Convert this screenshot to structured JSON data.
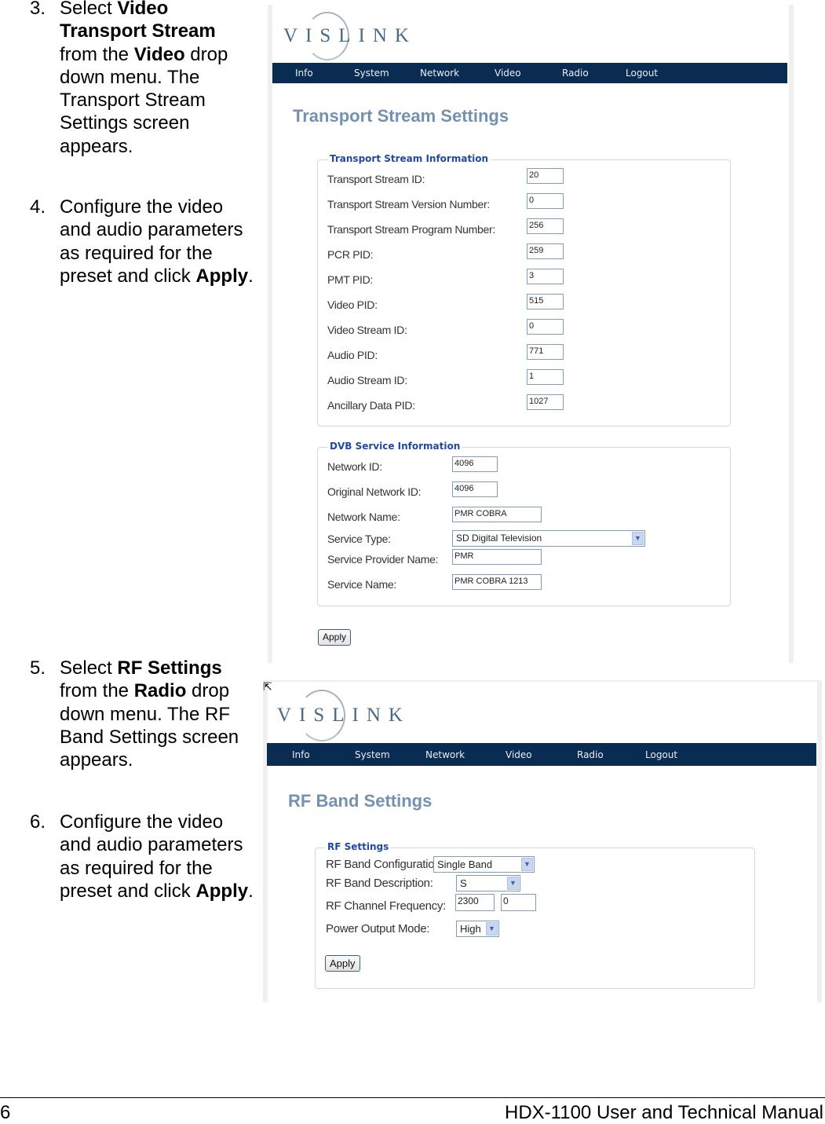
{
  "steps": [
    {
      "num": "3.",
      "parts": [
        "Select ",
        "Video Transport Stream",
        " from the ",
        "Video",
        " drop down menu. The Transport Stream Settings screen appears."
      ]
    },
    {
      "num": "4.",
      "parts": [
        "Configure the video and audio parameters as required for the preset and click ",
        "Apply",
        "."
      ]
    },
    {
      "num": "5.",
      "parts": [
        "Select ",
        "RF Settings",
        " from the ",
        "Radio",
        " drop down menu. The RF Band Settings screen appears."
      ]
    },
    {
      "num": "6.",
      "parts": [
        "Configure the video and audio parameters as required for the preset and click ",
        "Apply",
        "."
      ]
    }
  ],
  "brand": "VISLINK",
  "nav": [
    "Info",
    "System",
    "Network",
    "Video",
    "Radio",
    "Logout"
  ],
  "ts_screen": {
    "title": "Transport Stream Settings",
    "ts_info": {
      "legend": "Transport Stream Information",
      "fields": [
        {
          "label": "Transport Stream ID:",
          "value": "20"
        },
        {
          "label": "Transport Stream Version Number:",
          "value": "0"
        },
        {
          "label": "Transport Stream Program Number:",
          "value": "256"
        },
        {
          "label": "PCR PID:",
          "value": "259"
        },
        {
          "label": "PMT PID:",
          "value": "3"
        },
        {
          "label": "Video PID:",
          "value": "515"
        },
        {
          "label": "Video Stream ID:",
          "value": "0"
        },
        {
          "label": "Audio PID:",
          "value": "771"
        },
        {
          "label": "Audio Stream ID:",
          "value": "1"
        },
        {
          "label": "Ancillary Data PID:",
          "value": "1027"
        }
      ]
    },
    "dvb_info": {
      "legend": "DVB Service Information",
      "network_id_label": "Network ID:",
      "network_id": "4096",
      "orig_network_id_label": "Original Network ID:",
      "orig_network_id": "4096",
      "network_name_label": "Network Name:",
      "network_name": "PMR COBRA",
      "service_type_label": "Service Type:",
      "service_type": "SD Digital Television",
      "provider_label": "Service Provider Name:",
      "provider": "PMR",
      "service_name_label": "Service Name:",
      "service_name": "PMR COBRA 1213"
    },
    "apply": "Apply"
  },
  "rf_screen": {
    "title": "RF Band Settings",
    "legend": "RF Settings",
    "band_config_label": "RF Band Configuration:",
    "band_config": "Single Band",
    "band_desc_label": "RF Band Description:",
    "band_desc": "S",
    "freq_label": "RF Channel Frequency:",
    "freq_mhz": "2300",
    "freq_frac": "0",
    "power_label": "Power Output Mode:",
    "power": "High",
    "apply": "Apply"
  },
  "footer": {
    "page": "6",
    "title": "HDX-1100 User and Technical Manual"
  }
}
